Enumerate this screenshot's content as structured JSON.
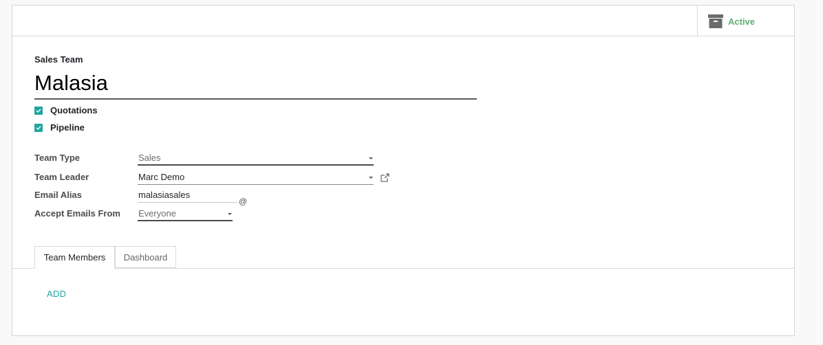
{
  "header": {
    "active_label": "Active",
    "archive_icon": "archive-box-icon"
  },
  "form": {
    "team_label": "Sales Team",
    "team_name": "Malasia",
    "checkboxes": [
      {
        "label": "Quotations",
        "checked": true
      },
      {
        "label": "Pipeline",
        "checked": true
      }
    ],
    "fields": {
      "team_type": {
        "label": "Team Type",
        "value": "Sales"
      },
      "team_leader": {
        "label": "Team Leader",
        "value": "Marc Demo"
      },
      "email_alias": {
        "label": "Email Alias",
        "value": "malasiasales",
        "suffix": "@"
      },
      "accept_emails": {
        "label": "Accept Emails From",
        "value": "Everyone"
      }
    }
  },
  "tabs": [
    {
      "label": "Team Members",
      "active": true
    },
    {
      "label": "Dashboard",
      "active": false
    }
  ],
  "members": {
    "add_label": "ADD"
  },
  "colors": {
    "accent": "#21a4a0",
    "active_green": "#5fae6e"
  }
}
